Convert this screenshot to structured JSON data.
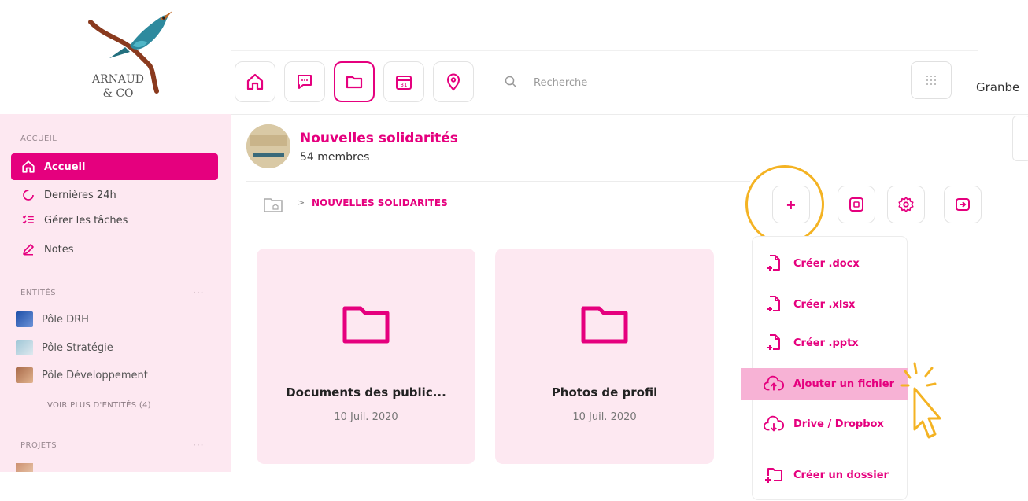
{
  "brand": {
    "line1": "ARNAUD",
    "line2": "& CO"
  },
  "topnav": {
    "search_placeholder": "Recherche",
    "user_name": "Granbe"
  },
  "sidebar": {
    "section_home": "ACCUEIL",
    "items": [
      {
        "label": "Accueil",
        "icon": "home-icon",
        "active": true
      },
      {
        "label": "Dernières 24h",
        "icon": "history-icon"
      },
      {
        "label": "Gérer les tâches",
        "icon": "tasks-icon"
      },
      {
        "label": "Notes",
        "icon": "pen-icon"
      }
    ],
    "section_entities": "ENTITÉS",
    "entities": [
      {
        "label": "Pôle DRH"
      },
      {
        "label": "Pôle Stratégie"
      },
      {
        "label": "Pôle Développement"
      }
    ],
    "more_entities": "VOIR PLUS D'ENTITÉS (4)",
    "section_projects": "PROJETS",
    "dots": "···"
  },
  "group": {
    "name": "Nouvelles solidarités",
    "members": "54 membres"
  },
  "breadcrumb": {
    "separator": ">",
    "label": "NOUVELLES SOLIDARITES"
  },
  "actions": {
    "add_label": "+"
  },
  "folders": [
    {
      "title": "Documents des public...",
      "date": "10 Juil. 2020"
    },
    {
      "title": "Photos de profil",
      "date": "10 Juil. 2020"
    }
  ],
  "menu": {
    "items": [
      {
        "label": "Créer .docx",
        "icon": "file-plus-icon"
      },
      {
        "label": "Créer .xlsx",
        "icon": "file-plus-icon"
      },
      {
        "label": "Créer .pptx",
        "icon": "file-plus-icon"
      },
      {
        "label": "Ajouter un fichier",
        "icon": "cloud-upload-icon",
        "highlighted": true
      },
      {
        "label": "Drive / Dropbox",
        "icon": "cloud-download-icon"
      },
      {
        "label": "Créer un dossier",
        "icon": "folder-plus-icon"
      }
    ]
  },
  "colors": {
    "accent": "#e5007e",
    "sidebar_bg": "#fde8f1",
    "highlight_ring": "#f4b323",
    "menu_highlight": "#f7b2d5"
  }
}
